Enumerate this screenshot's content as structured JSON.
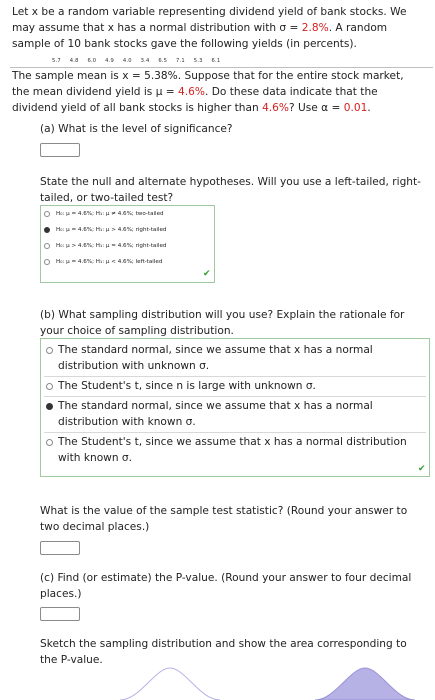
{
  "problem": {
    "l1": "Let x be a random variable representing dividend yield of bank stocks. We",
    "l2a": "may assume that x has a normal distribution with σ = ",
    "l2b": "2.8%",
    "l2c": ". A random",
    "l3": "sample of 10 bank stocks gave the following yields (in percents).",
    "l4a": "The sample mean is x = 5.38%. Suppose that for the entire stock market,",
    "l5a": "the mean dividend yield is μ = ",
    "l5b": "4.6%",
    "l5c": ". Do these data indicate that the",
    "l6a": "dividend yield of all bank stocks is higher than ",
    "l6b": "4.6%",
    "l6c": "? Use α = ",
    "l6d": "0.01",
    "l6e": "."
  },
  "yields": [
    "5.7",
    "4.8",
    "6.0",
    "4.9",
    "4.0",
    "3.4",
    "6.5",
    "7.1",
    "5.3",
    "6.1"
  ],
  "part_a": {
    "q": "(a) What is the level of significance?",
    "answer": ""
  },
  "hypotheses": {
    "q1": "State the null and alternate hypotheses. Will you use a left-tailed, right-",
    "q2": "tailed, or two-tailed test?",
    "options": [
      {
        "label": "H₀: μ = 4.6%; H₁: μ ≠ 4.6%; two-tailed"
      },
      {
        "label": "H₀: μ = 4.6%; H₁: μ > 4.6%; right-tailed"
      },
      {
        "label": "H₀: μ > 4.6%; H₁: μ = 4.6%; right-tailed"
      },
      {
        "label": "H₀: μ = 4.6%; H₁: μ < 4.6%; left-tailed"
      }
    ],
    "selected": 1
  },
  "part_b": {
    "q1": "(b) What sampling distribution will you use? Explain the rationale for",
    "q2": "your choice of sampling distribution.",
    "options": [
      {
        "l1": "The standard normal, since we assume that x has a normal",
        "l2": "distribution with unknown σ."
      },
      {
        "l1": "The Student's t, since n is large with unknown σ.",
        "l2": ""
      },
      {
        "l1": "The standard normal, since we assume that x has a normal",
        "l2": "distribution with known σ."
      },
      {
        "l1": "The Student's t, since we assume that x has a normal distribution",
        "l2": "with known σ."
      }
    ],
    "selected": 2
  },
  "test_stat": {
    "q1": "What is the value of the sample test statistic? (Round your answer to",
    "q2": "two decimal places.)",
    "answer": ""
  },
  "part_c": {
    "q1": "(c) Find (or estimate) the P-value. (Round your answer to four decimal",
    "q2": "places.)",
    "answer": ""
  },
  "sketch": {
    "q1": "Sketch the sampling distribution and show the area corresponding to",
    "q2": "the P-value."
  },
  "colors": {
    "red": "#d62020",
    "check": "#2e9e2e",
    "panel_border": "#9fc99f",
    "curve_fill": "#b7b2e6"
  }
}
